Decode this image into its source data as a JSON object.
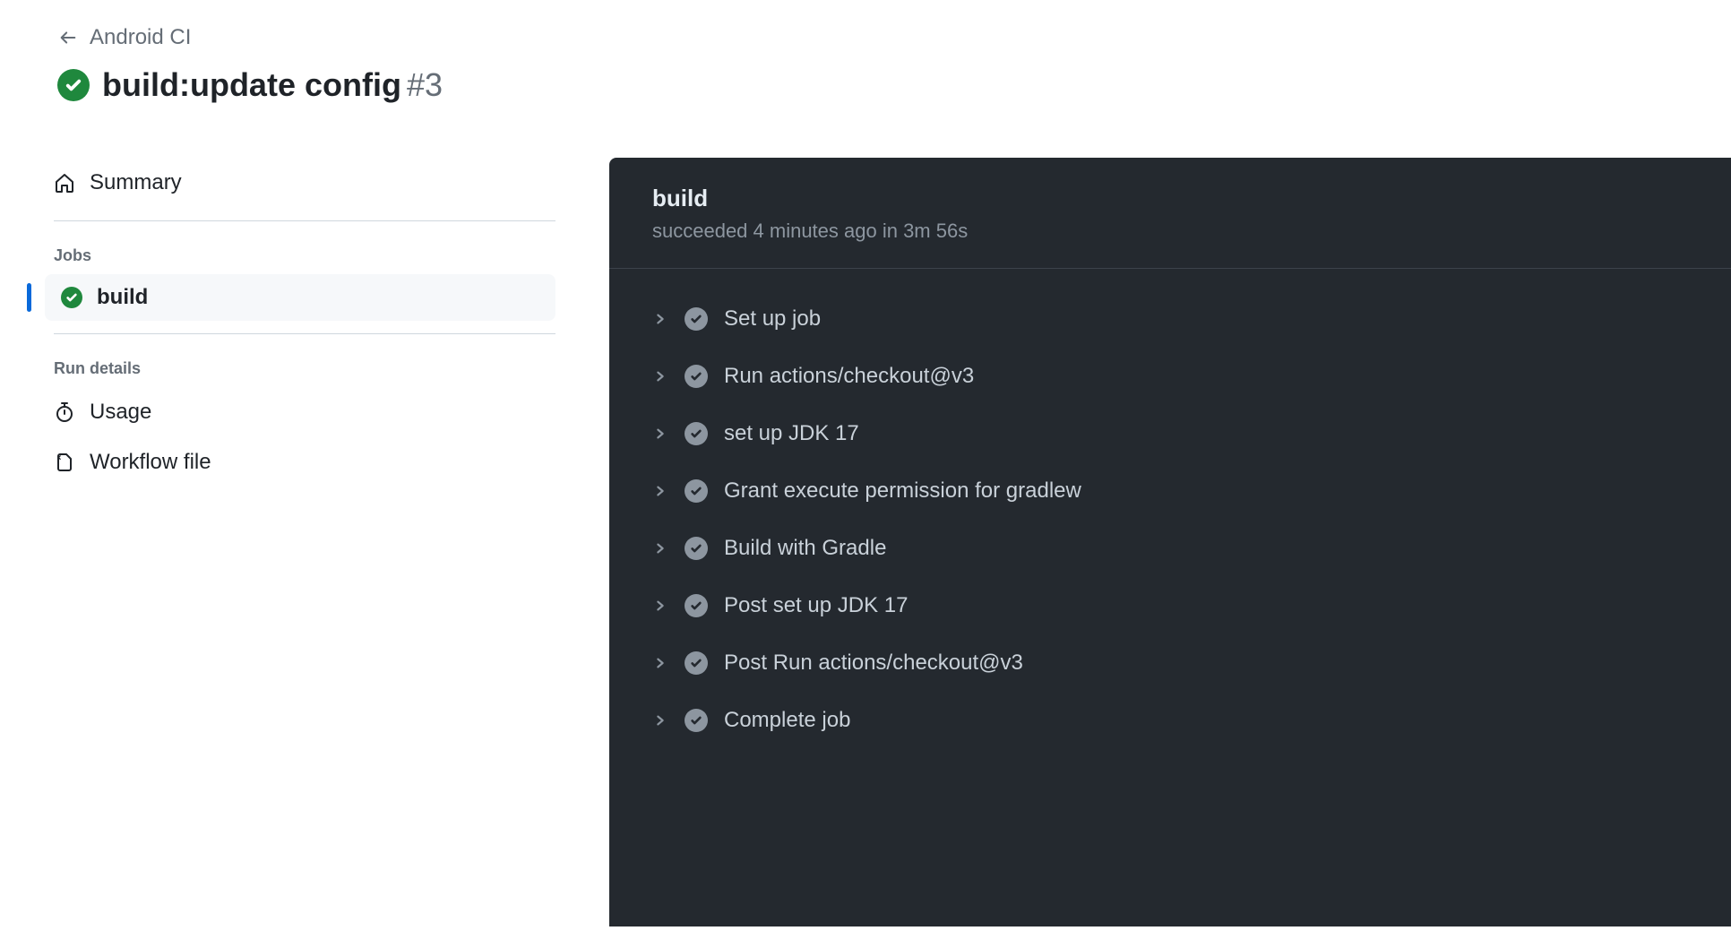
{
  "breadcrumb": {
    "parent": "Android CI"
  },
  "title": {
    "name": "build:update config",
    "run_number": "#3"
  },
  "sidebar": {
    "summary_label": "Summary",
    "jobs_heading": "Jobs",
    "jobs": [
      {
        "label": "build",
        "status": "success"
      }
    ],
    "run_details_heading": "Run details",
    "run_details": [
      {
        "label": "Usage",
        "icon": "stopwatch-icon"
      },
      {
        "label": "Workflow file",
        "icon": "file-code-icon"
      }
    ]
  },
  "log": {
    "title": "build",
    "subtitle": "succeeded 4 minutes ago in 3m 56s",
    "steps": [
      {
        "label": "Set up job"
      },
      {
        "label": "Run actions/checkout@v3"
      },
      {
        "label": "set up JDK 17"
      },
      {
        "label": "Grant execute permission for gradlew"
      },
      {
        "label": "Build with Gradle"
      },
      {
        "label": "Post set up JDK 17"
      },
      {
        "label": "Post Run actions/checkout@v3"
      },
      {
        "label": "Complete job"
      }
    ]
  }
}
